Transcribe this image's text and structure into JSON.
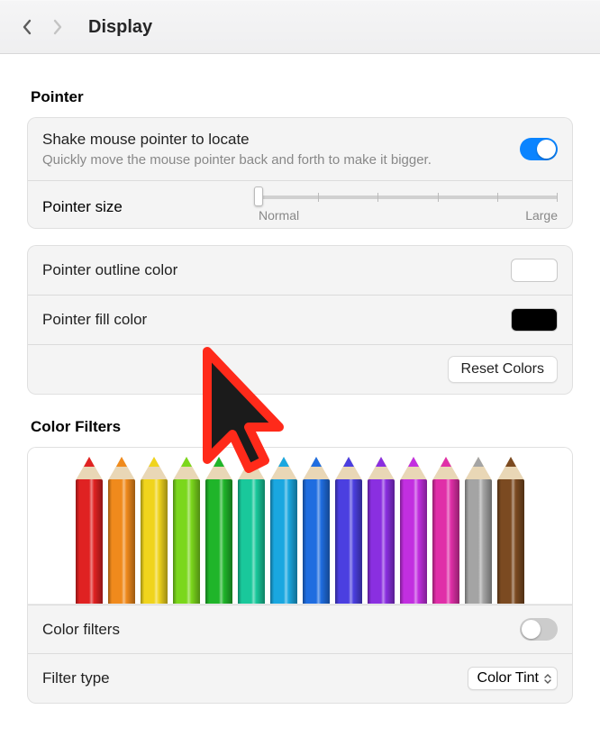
{
  "header": {
    "title": "Display"
  },
  "pointer": {
    "heading": "Pointer",
    "shake": {
      "label": "Shake mouse pointer to locate",
      "sub": "Quickly move the mouse pointer back and forth to make it bigger.",
      "on": true
    },
    "size": {
      "label": "Pointer size",
      "min_label": "Normal",
      "max_label": "Large",
      "value": 0
    },
    "outline": {
      "label": "Pointer outline color",
      "color": "#ffffff"
    },
    "fill": {
      "label": "Pointer fill color",
      "color": "#000000"
    },
    "reset_label": "Reset Colors"
  },
  "color_filters": {
    "heading": "Color Filters",
    "pencil_colors": [
      "#e02222",
      "#f08a1c",
      "#f0d41c",
      "#7bd71c",
      "#1fb52a",
      "#19c89b",
      "#1aa7e0",
      "#1f6de0",
      "#4b3fe0",
      "#8a2fe0",
      "#c22fe0",
      "#e02fa8",
      "#a4a4a4",
      "#7b4a21"
    ],
    "filters_toggle": {
      "label": "Color filters",
      "on": false
    },
    "filter_type": {
      "label": "Filter type",
      "value": "Color Tint"
    }
  }
}
